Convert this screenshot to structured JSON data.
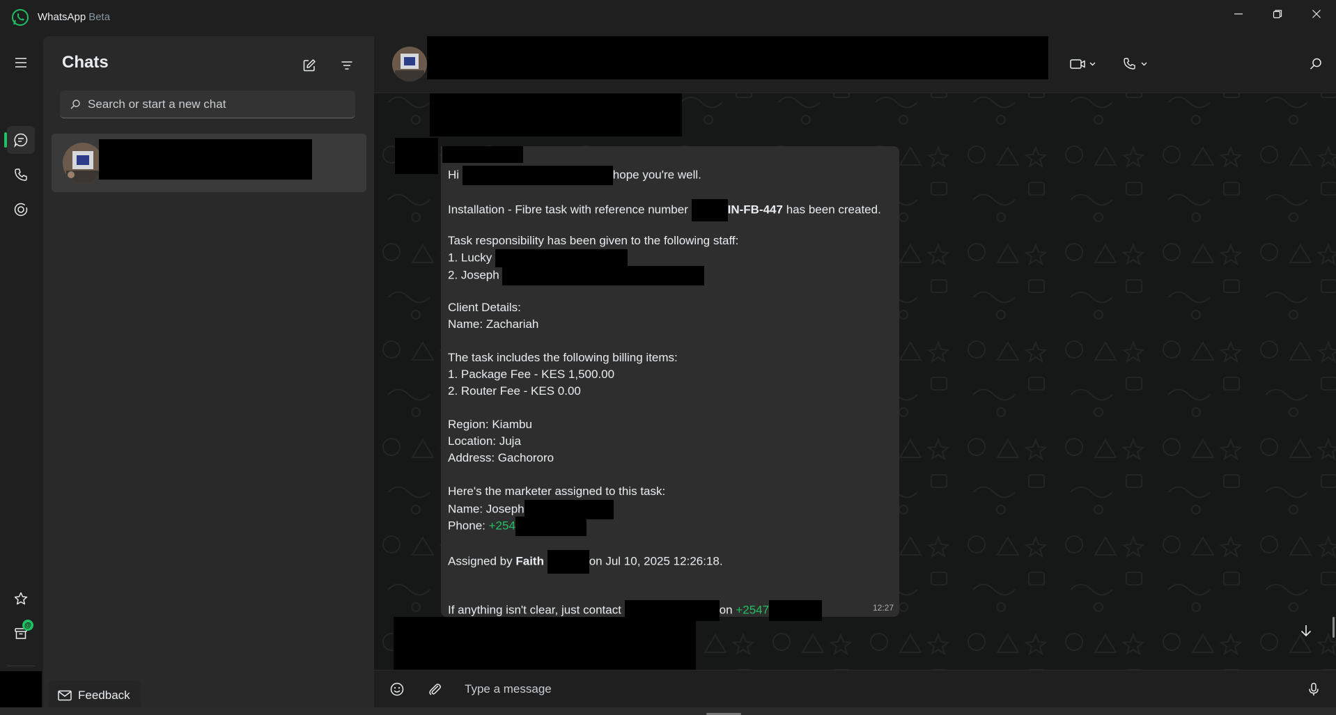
{
  "window": {
    "app_name": "WhatsApp",
    "app_tag": "Beta"
  },
  "colors": {
    "accent": "#21c063",
    "background": "#161717",
    "panel": "#292929",
    "bubble": "#2e2e2e"
  },
  "rail": {
    "items": [
      {
        "icon": "menu-icon"
      },
      {
        "icon": "chats-icon",
        "active": true
      },
      {
        "icon": "calls-icon"
      },
      {
        "icon": "status-icon"
      },
      {
        "icon": "starred-icon"
      },
      {
        "icon": "archive-icon",
        "badge": "@"
      },
      {
        "icon": "settings-icon"
      }
    ]
  },
  "chatlist": {
    "title": "Chats",
    "search_placeholder": "Search or start a new chat",
    "feedback_label": "Feedback"
  },
  "message": {
    "greeting_pre": "Hi",
    "greeting_post": "hope you're well.",
    "install_pre": "Installation - Fibre task with reference number",
    "reference": "IN-FB-447",
    "install_post": "has been created.",
    "staff_intro": "Task responsibility has been given to the following staff:",
    "staff_1": "1. Lucky",
    "staff_2": "2. Joseph",
    "client_heading": "Client Details:",
    "client_name": "Name: Zachariah",
    "billing_intro": "The task includes the following billing items:",
    "billing_1": "1. Package Fee - KES 1,500.00",
    "billing_2": "2. Router Fee - KES 0.00",
    "region": "Region: Kiambu",
    "location": "Location: Juja",
    "address": "Address: Gachororo",
    "marketer_intro": "Here's the marketer assigned to this task:",
    "marketer_name": "Name: Joseph",
    "marketer_phone_label": "Phone:",
    "marketer_phone": "+254",
    "assigned_pre": "Assigned by",
    "assigned_by": "Faith",
    "assigned_post": "on Jul 10, 2025 12:26:18.",
    "contact_pre": "If anything isn't clear, just contact",
    "contact_mid": "on",
    "contact_phone": "+2547",
    "time": "12:27"
  },
  "composer": {
    "placeholder": "Type a message"
  }
}
